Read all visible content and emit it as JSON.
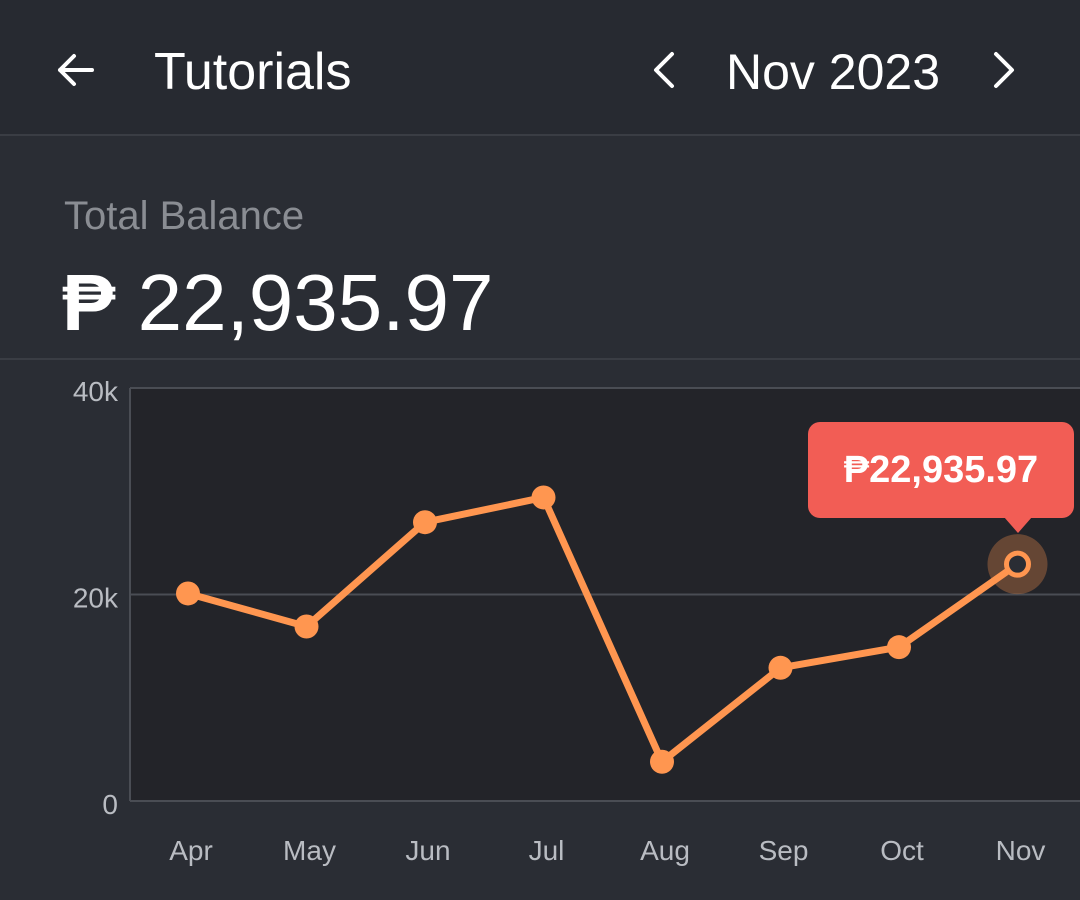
{
  "app_bar": {
    "back_icon": "arrow-left-icon",
    "title": "Tutorials",
    "prev_icon": "chevron-left-icon",
    "month": "Nov 2023",
    "next_icon": "chevron-right-icon"
  },
  "balance": {
    "label": "Total Balance",
    "currency_symbol": "₱",
    "amount": "22,935.97"
  },
  "tooltip": {
    "text": "₱22,935.97"
  },
  "colors": {
    "background": "#2a2d34",
    "plot_background": "#232429",
    "line": "#ff9650",
    "tooltip": "#f25d55",
    "axis_text": "#b9bcc2",
    "muted_text": "#8a8d93"
  },
  "chart_data": {
    "type": "line",
    "categories": [
      "Apr",
      "May",
      "Jun",
      "Jul",
      "Aug",
      "Sep",
      "Oct",
      "Nov"
    ],
    "values": [
      20100,
      16900,
      27000,
      29400,
      3800,
      12900,
      14900,
      22935.97
    ],
    "ylim": [
      0,
      40000
    ],
    "yticks": [
      0,
      20000,
      40000
    ],
    "ytick_labels": [
      "0",
      "20k",
      "40k"
    ],
    "grid": true,
    "highlighted_index": 7
  }
}
